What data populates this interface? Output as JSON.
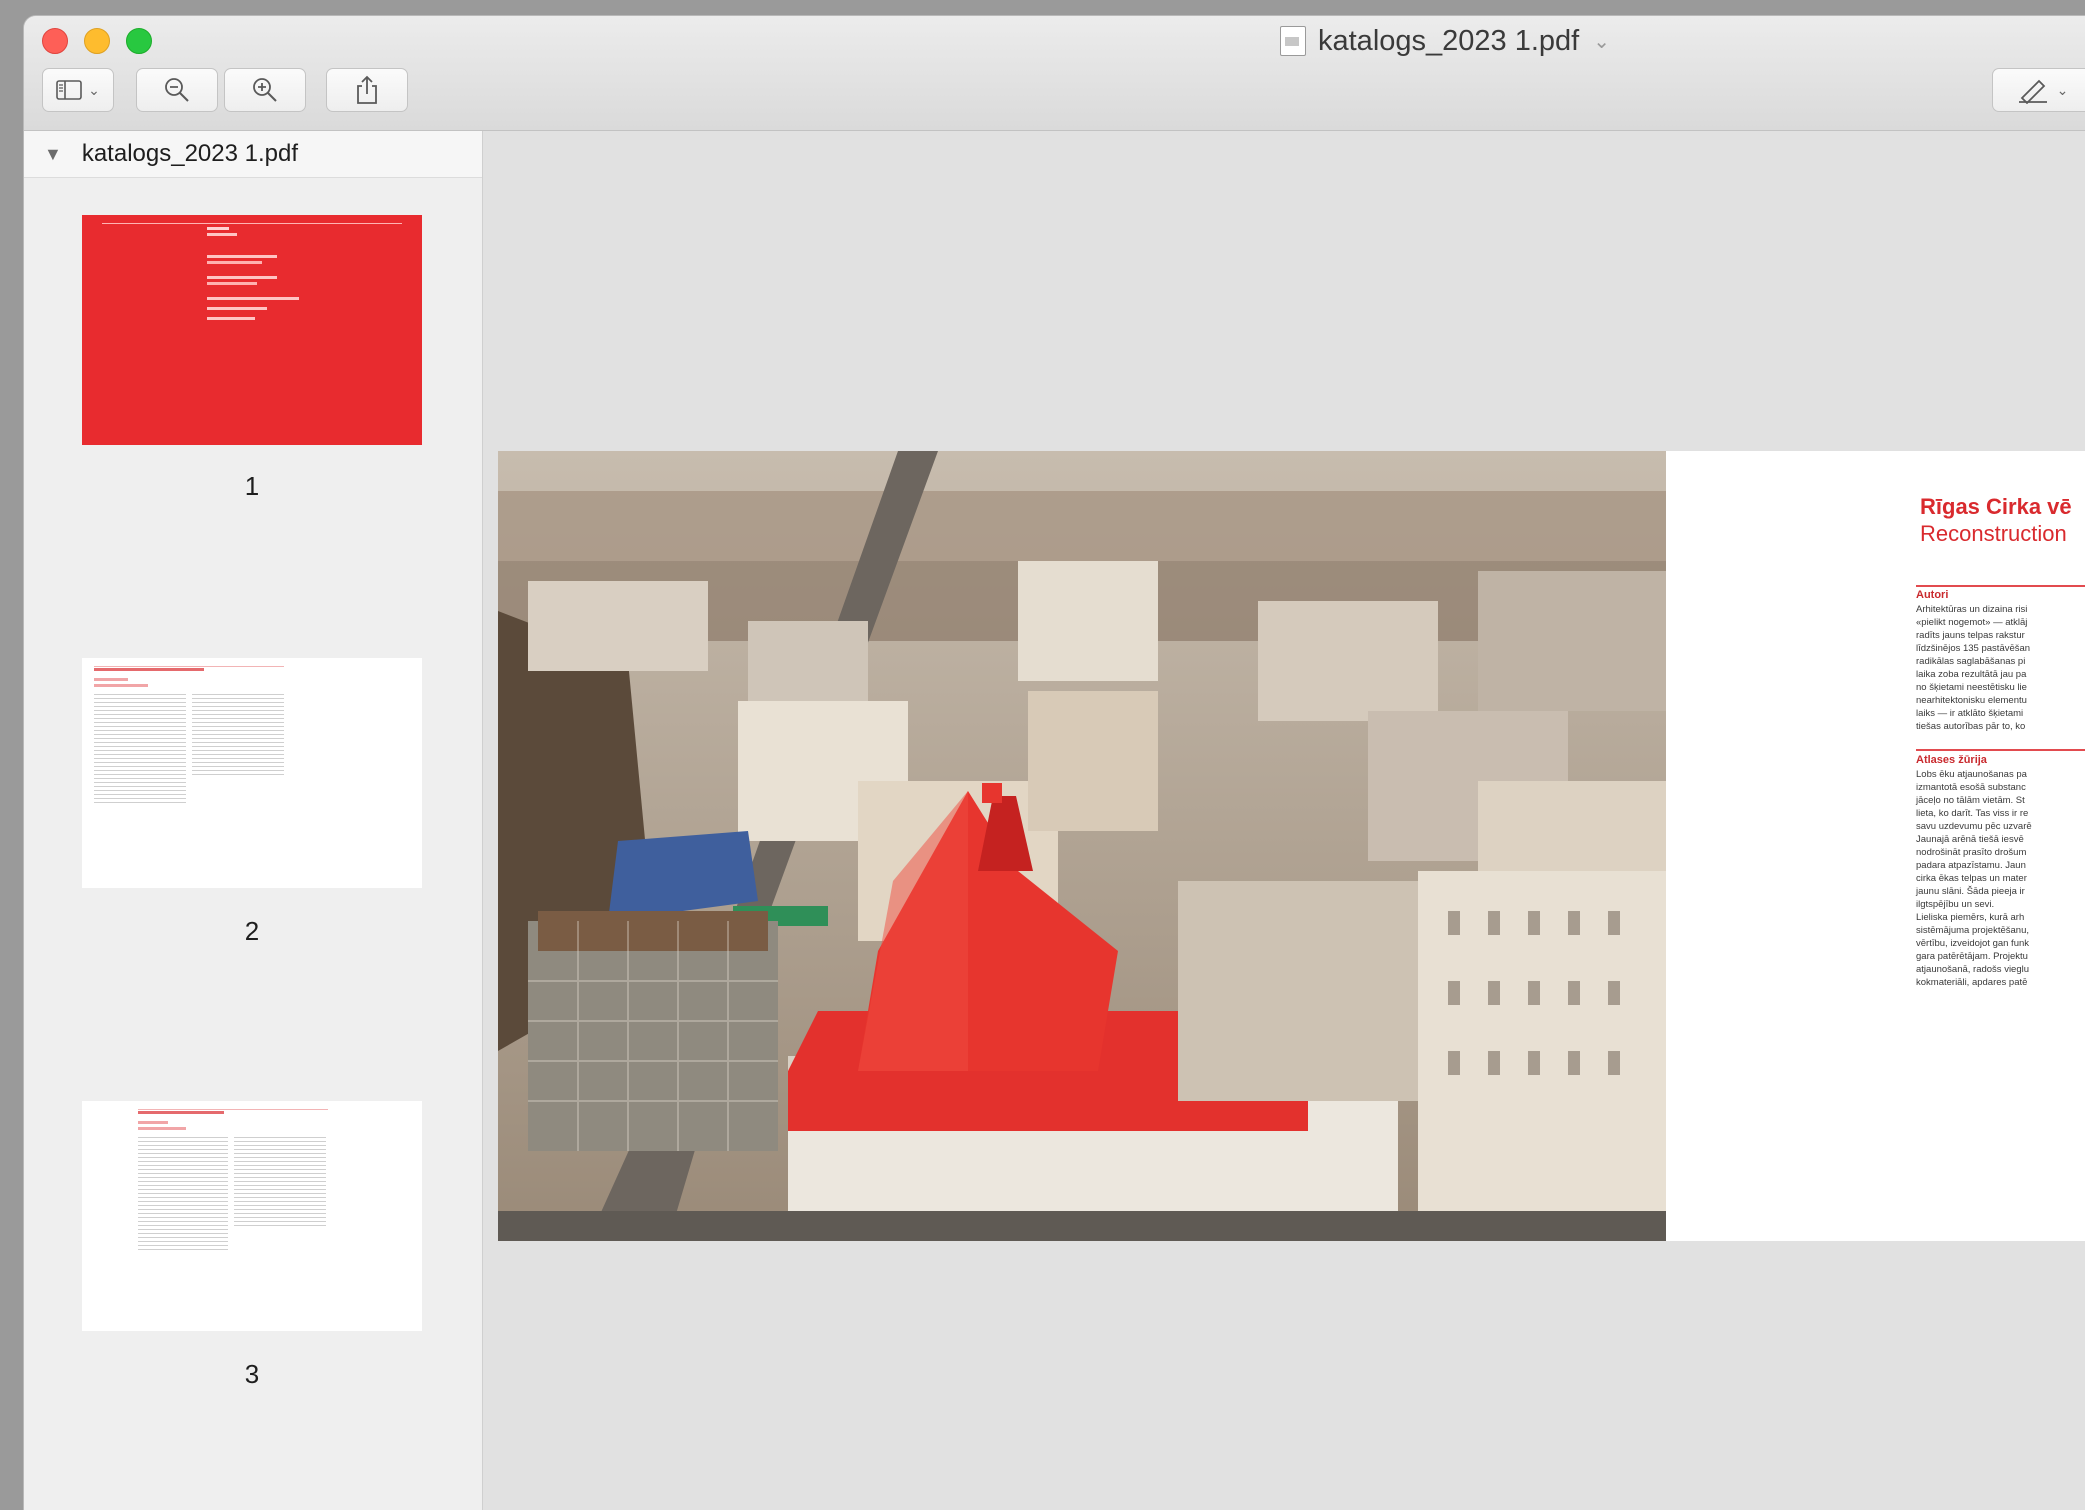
{
  "window": {
    "title": "katalogs_2023 1.pdf"
  },
  "sidebar": {
    "header": "katalogs_2023 1.pdf",
    "pages": [
      {
        "number": "1"
      },
      {
        "number": "2"
      },
      {
        "number": "3"
      }
    ]
  },
  "document": {
    "article_title": "Rīgas Cirka vē",
    "article_subtitle": "Reconstruction",
    "section1_heading": "Autori",
    "section1_lines": [
      "Arhitektūras un dizaina risi",
      "«pielikt nogemot» — atklāj",
      "radīts jauns telpas rakstur",
      "līdzšinējos 135 pastāvēšan",
      "radikālas saglabāšanas pi",
      "laika zoba rezultātā jau pa",
      "no šķietami neestētisku lie",
      "nearhitektonisku elementu",
      "laiks — ir atklāto šķietami",
      "tiešas autorības pār to, ko"
    ],
    "section2_heading": "Atlases žūrija",
    "section2_lines": [
      "Lobs ēku atjaunošanas pa",
      "izmantotā esošā substanc",
      "jāceļo no tālām vietām. St",
      "lieta, ko darīt. Tas viss ir re",
      "savu uzdevumu pēc uzvarē",
      "Jaunajā arēnā tiešā iesvē",
      "nodrošināt prasīto drošum",
      "padara atpazīstamu. Jaun",
      "cirka ēkas telpas un mater",
      "jaunu slāni. Šāda pieeja ir",
      "ilgtspējību un sevi.",
      "Lieliska piemērs, kurā arh",
      "sistēmājuma projektēšanu,",
      "vērtību, izveidojot gan funk",
      "gara patērētājam. Projektu",
      "atjaunošanā, radošs vieglu",
      "kokmateriāli, apdares patē"
    ]
  },
  "colors": {
    "accent_red": "#e82b2f",
    "title_red": "#d92a2e",
    "window_bg": "#e3e3e3"
  },
  "icons": {
    "close": "close-icon",
    "minimize": "minimize-icon",
    "maximize": "maximize-icon",
    "sidebar_toggle": "sidebar-toggle-icon",
    "zoom_out": "zoom-out-icon",
    "zoom_in": "zoom-in-icon",
    "share": "share-icon",
    "markup": "markup-pen-icon"
  }
}
